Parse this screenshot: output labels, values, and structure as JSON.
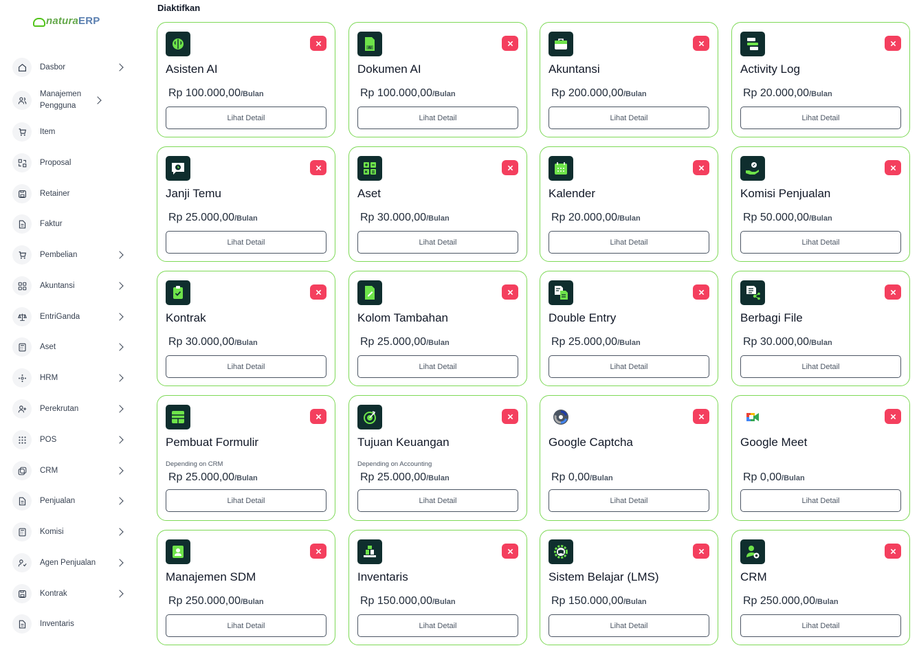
{
  "brand": {
    "part1": "natura",
    "part2": "ERP"
  },
  "sidebar": {
    "items": [
      {
        "label": "Dasbor",
        "icon": "home-icon",
        "chevron": true
      },
      {
        "label": "Manajemen Pengguna",
        "icon": "users-icon",
        "chevron": true
      },
      {
        "label": "Item",
        "icon": "cart-icon",
        "chevron": false
      },
      {
        "label": "Proposal",
        "icon": "swap-icon",
        "chevron": false
      },
      {
        "label": "Retainer",
        "icon": "save-icon",
        "chevron": false
      },
      {
        "label": "Faktur",
        "icon": "file-icon",
        "chevron": false
      },
      {
        "label": "Pembelian",
        "icon": "cart-icon",
        "chevron": true
      },
      {
        "label": "Akuntansi",
        "icon": "grid-icon",
        "chevron": true
      },
      {
        "label": "EntriGanda",
        "icon": "scale-icon",
        "chevron": true
      },
      {
        "label": "Aset",
        "icon": "calculator-icon",
        "chevron": true
      },
      {
        "label": "HRM",
        "icon": "cluster-icon",
        "chevron": true
      },
      {
        "label": "Perekrutan",
        "icon": "user-plus-icon",
        "chevron": true
      },
      {
        "label": "POS",
        "icon": "dots-grid-icon",
        "chevron": true
      },
      {
        "label": "CRM",
        "icon": "layers-icon",
        "chevron": true
      },
      {
        "label": "Penjualan",
        "icon": "file-icon",
        "chevron": true
      },
      {
        "label": "Komisi",
        "icon": "calculator-icon",
        "chevron": true
      },
      {
        "label": "Agen Penjualan",
        "icon": "user-check-icon",
        "chevron": true
      },
      {
        "label": "Kontrak",
        "icon": "save-icon",
        "chevron": true
      },
      {
        "label": "Inventaris",
        "icon": "file-icon",
        "chevron": false
      }
    ]
  },
  "main": {
    "section_title": "Diaktifkan",
    "price_unit": "/Bulan",
    "detail_label": "Lihat Detail",
    "modules": [
      {
        "name": "Asisten AI",
        "price": "Rp 100.000,00",
        "icon": "brain-icon",
        "dependency": ""
      },
      {
        "name": "Dokumen AI",
        "price": "Rp 100.000,00",
        "icon": "ai-document-icon",
        "dependency": ""
      },
      {
        "name": "Akuntansi",
        "price": "Rp 200.000,00",
        "icon": "briefcase-icon",
        "dependency": ""
      },
      {
        "name": "Activity Log",
        "price": "Rp 20.000,00",
        "icon": "activity-log-icon",
        "dependency": ""
      },
      {
        "name": "Janji Temu",
        "price": "Rp 25.000,00",
        "icon": "clock-chat-icon",
        "dependency": ""
      },
      {
        "name": "Aset",
        "price": "Rp 30.000,00",
        "icon": "calculator-icon",
        "dependency": ""
      },
      {
        "name": "Kalender",
        "price": "Rp 20.000,00",
        "icon": "calendar-icon",
        "dependency": ""
      },
      {
        "name": "Komisi Penjualan",
        "price": "Rp 50.000,00",
        "icon": "hand-coin-icon",
        "dependency": ""
      },
      {
        "name": "Kontrak",
        "price": "Rp 30.000,00",
        "icon": "clipboard-check-icon",
        "dependency": ""
      },
      {
        "name": "Kolom Tambahan",
        "price": "Rp 25.000,00",
        "icon": "file-edit-icon",
        "dependency": ""
      },
      {
        "name": "Double Entry",
        "price": "Rp 25.000,00",
        "icon": "double-entry-icon",
        "dependency": ""
      },
      {
        "name": "Berbagi File",
        "price": "Rp 30.000,00",
        "icon": "file-share-icon",
        "dependency": ""
      },
      {
        "name": "Pembuat Formulir",
        "price": "Rp 25.000,00",
        "icon": "form-table-icon",
        "dependency": "Depending on CRM"
      },
      {
        "name": "Tujuan Keuangan",
        "price": "Rp 25.000,00",
        "icon": "target-icon",
        "dependency": "Depending on Accounting"
      },
      {
        "name": "Google Captcha",
        "price": "Rp 0,00",
        "icon": "recaptcha-icon",
        "dependency": ""
      },
      {
        "name": "Google Meet",
        "price": "Rp 0,00",
        "icon": "google-meet-icon",
        "dependency": ""
      },
      {
        "name": "Manajemen SDM",
        "price": "Rp 250.000,00",
        "icon": "id-badge-icon",
        "dependency": ""
      },
      {
        "name": "Inventaris",
        "price": "Rp 150.000,00",
        "icon": "inventory-icon",
        "dependency": ""
      },
      {
        "name": "Sistem Belajar (LMS)",
        "price": "Rp 150.000,00",
        "icon": "gear-book-icon",
        "dependency": ""
      },
      {
        "name": "CRM",
        "price": "Rp 250.000,00",
        "icon": "user-view-icon",
        "dependency": ""
      }
    ]
  },
  "colors": {
    "card_border": "#7ed957",
    "icon_bg": "#0f2e2e",
    "accent_green": "#6ee34a",
    "remove_red": "#f43f5e"
  }
}
